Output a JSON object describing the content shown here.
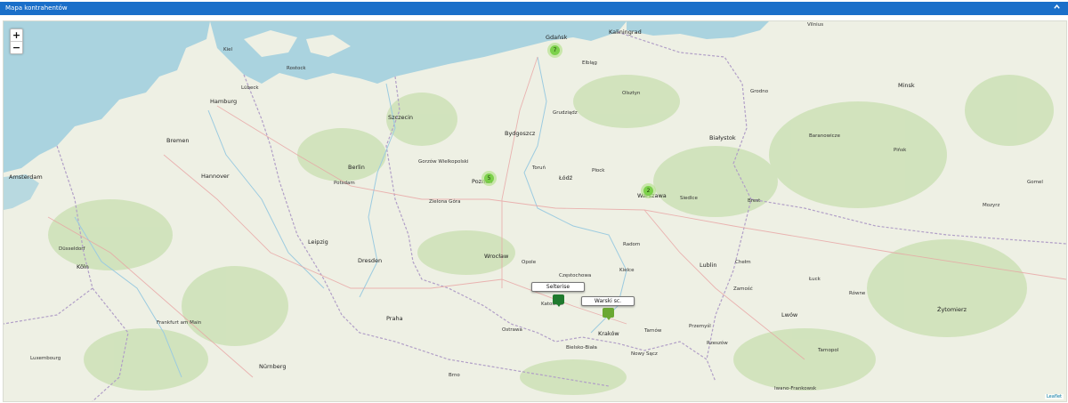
{
  "panel": {
    "title": "Mapa kontrahentów",
    "collapse_icon": "chevron-up-icon"
  },
  "map": {
    "zoom_in": "+",
    "zoom_out": "−",
    "attribution": "Leaflet",
    "colors": {
      "water": "#aad3df",
      "land": "#eef0e4",
      "forest": "#c8dfb0",
      "cluster_outer": "#b5e28c",
      "cluster_inner": "#6ecc39",
      "marker_dark": "#1f7a2e",
      "marker_light": "#6aa832",
      "border": "#b19fc7"
    },
    "clusters": [
      {
        "count": "7"
      },
      {
        "count": "5"
      },
      {
        "count": "2"
      }
    ],
    "markers": [
      {
        "label": "Selterise"
      },
      {
        "label": "Warski sc."
      }
    ],
    "place_labels": [
      "Kaliningrad",
      "Vilnius",
      "Minsk",
      "Gdańsk",
      "Elbląg",
      "Olsztyn",
      "Bydgoszcz",
      "Grudziądz",
      "Szczecin",
      "Hamburg",
      "Kiel",
      "Lübeck",
      "Rostock",
      "Bremen",
      "Hannover",
      "Berlin",
      "Potsdam",
      "Leipzig",
      "Dresden",
      "Poznań",
      "Łódź",
      "Warszawa",
      "Białystok",
      "Lublin",
      "Brest",
      "Wrocław",
      "Opole",
      "Kraków",
      "Katowice",
      "Częstochowa",
      "Kielce",
      "Radom",
      "Rzeszów",
      "Praha",
      "Amsterdam",
      "Köln",
      "Düsseldorf",
      "Frankfurt am Main",
      "Nürnberg",
      "Luxembourg",
      "Lwów",
      "Żytomierz",
      "Równe",
      "Tarnopol",
      "Iwano-Frankowsk",
      "Łuck",
      "Grodno",
      "Baranowicze",
      "Pińsk",
      "Gomel",
      "Mozyrz",
      "Bielsko-Biała",
      "Ostrawa",
      "Brno",
      "Gorzów Wielkopolski",
      "Zielona Góra",
      "Toruń",
      "Płock",
      "Siedlce",
      "Chełm",
      "Zamość",
      "Przemyśl",
      "Nowy Sącz",
      "Tarnów"
    ]
  }
}
